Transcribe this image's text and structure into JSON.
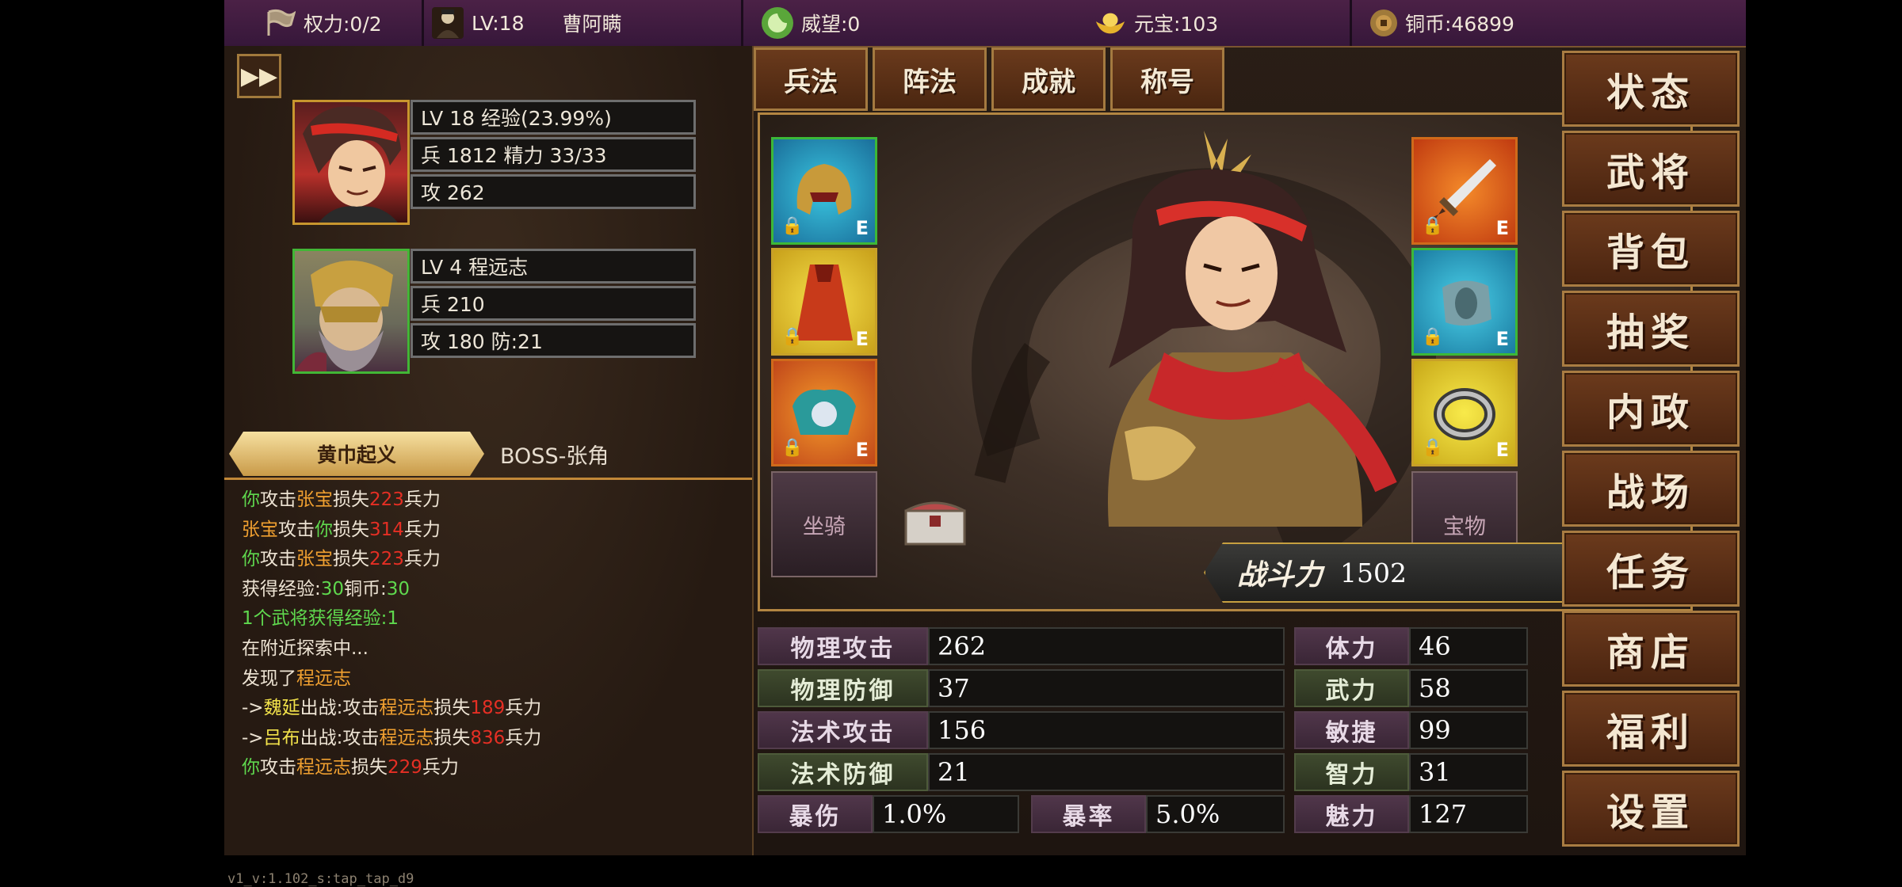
{
  "topbar": {
    "power": "权力:0/2",
    "level": "LV:18",
    "player_name": "曹阿瞒",
    "prestige": "威望:0",
    "yuanbao": "元宝:103",
    "copper": "铜币:46899"
  },
  "left": {
    "hero1": {
      "line1": "LV 18 经验(23.99%)",
      "line2": "兵 1812 精力 33/33",
      "line3": "攻 262"
    },
    "hero2": {
      "line1": "LV 4  程远志",
      "line2": "兵 210",
      "line3": "攻 180 防:21"
    },
    "quest_tab": "黄巾起义",
    "quest_boss": "BOSS-张角",
    "version": "v1_v:1.102_s:tap_tap_d9"
  },
  "log": [
    [
      "你",
      "攻击",
      "张宝",
      "损失",
      "223",
      "兵力"
    ],
    [
      "张宝",
      "攻击",
      "你",
      "损失",
      "314",
      "兵力"
    ],
    [
      "你",
      "攻击",
      "张宝",
      "损失",
      "223",
      "兵力"
    ],
    [
      "获得经验:",
      "30",
      "铜币:",
      "30"
    ],
    [
      "1个武将获得经验:1"
    ],
    [
      "在附近探索中..."
    ],
    [
      "发现了",
      "程远志"
    ],
    [
      "->",
      "魏延",
      "出战:攻击",
      "程远志",
      "损失",
      "189",
      "兵力"
    ],
    [
      "->",
      "吕布",
      "出战:攻击",
      "程远志",
      "损失",
      "836",
      "兵力"
    ],
    [
      "你",
      "攻击",
      "程远志",
      "损失",
      "229",
      "兵力"
    ]
  ],
  "tabs": [
    "兵法",
    "阵法",
    "成就",
    "称号"
  ],
  "equip": {
    "lock_symbol": "🔒",
    "e_label": "E",
    "mount": "坐骑",
    "treasure": "宝物"
  },
  "power": {
    "label": "战斗力",
    "value": "1502"
  },
  "stats": {
    "phys_atk_label": "物理攻击",
    "phys_atk": "262",
    "phys_def_label": "物理防御",
    "phys_def": "37",
    "mag_atk_label": "法术攻击",
    "mag_atk": "156",
    "mag_def_label": "法术防御",
    "mag_def": "21",
    "crit_dmg_label": "暴伤",
    "crit_dmg": "1.0%",
    "crit_rate_label": "暴率",
    "crit_rate": "5.0%",
    "stamina_label": "体力",
    "stamina": "46",
    "force_label": "武力",
    "force": "58",
    "agility_label": "敏捷",
    "agility": "99",
    "intellect_label": "智力",
    "intellect": "31",
    "charm_label": "魅力",
    "charm": "127"
  },
  "menu": [
    "状态",
    "武将",
    "背包",
    "抽奖",
    "内政",
    "战场",
    "任务",
    "商店",
    "福利",
    "设置"
  ],
  "colors": {
    "accent_gold": "#b38642",
    "topbar_purple": "#4b2146",
    "log_green": "#5fd84e",
    "log_orange": "#f0a030",
    "log_red": "#e52f24"
  }
}
